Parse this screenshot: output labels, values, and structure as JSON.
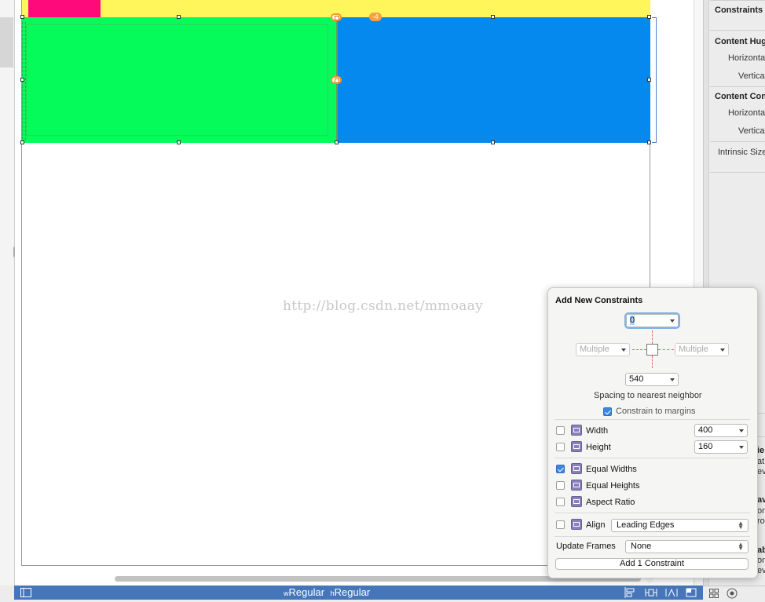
{
  "canvas": {
    "watermark": "http://blog.csdn.net/mmoaay",
    "conflict_badge": "-4"
  },
  "inspector": {
    "constraints_header": "Constraints",
    "content_hugging_header": "Content Hug",
    "hugging_horizontal": "Horizonta",
    "hugging_vertical": "Vertica",
    "compression_header": "Content Con",
    "compression_horizontal": "Horizonta",
    "compression_vertical": "Vertica",
    "intrinsic_size": "Intrinsic Size",
    "cut_fragments": [
      "ie",
      "at",
      "ev",
      "av",
      "on",
      "ro",
      "ab",
      "on",
      "ev"
    ]
  },
  "popover": {
    "title": "Add New Constraints",
    "top_value": "0",
    "left_value": "Multiple",
    "right_value": "Multiple",
    "bottom_value": "540",
    "spacing_label": "Spacing to nearest neighbor",
    "constrain_margins": {
      "label": "Constrain to margins",
      "checked": true
    },
    "width": {
      "label": "Width",
      "value": "400",
      "checked": false
    },
    "height": {
      "label": "Height",
      "value": "160",
      "checked": false
    },
    "equal_widths": {
      "label": "Equal Widths",
      "checked": true
    },
    "equal_heights": {
      "label": "Equal Heights",
      "checked": false
    },
    "aspect_ratio": {
      "label": "Aspect Ratio",
      "checked": false
    },
    "align": {
      "label": "Align",
      "value": "Leading Edges",
      "checked": false
    },
    "update_frames": {
      "label": "Update Frames",
      "value": "None"
    },
    "add_button": "Add 1 Constraint"
  },
  "bottombar": {
    "width_prefix": "w",
    "width_class": "Regular",
    "height_prefix": "h",
    "height_class": "Regular"
  },
  "colors": {
    "yellow_view": "#fef65b",
    "pink_view": "#ff0a7b",
    "green_view": "#05fb59",
    "blue_view": "#0689ef",
    "bottom_bar": "#4576b9"
  }
}
